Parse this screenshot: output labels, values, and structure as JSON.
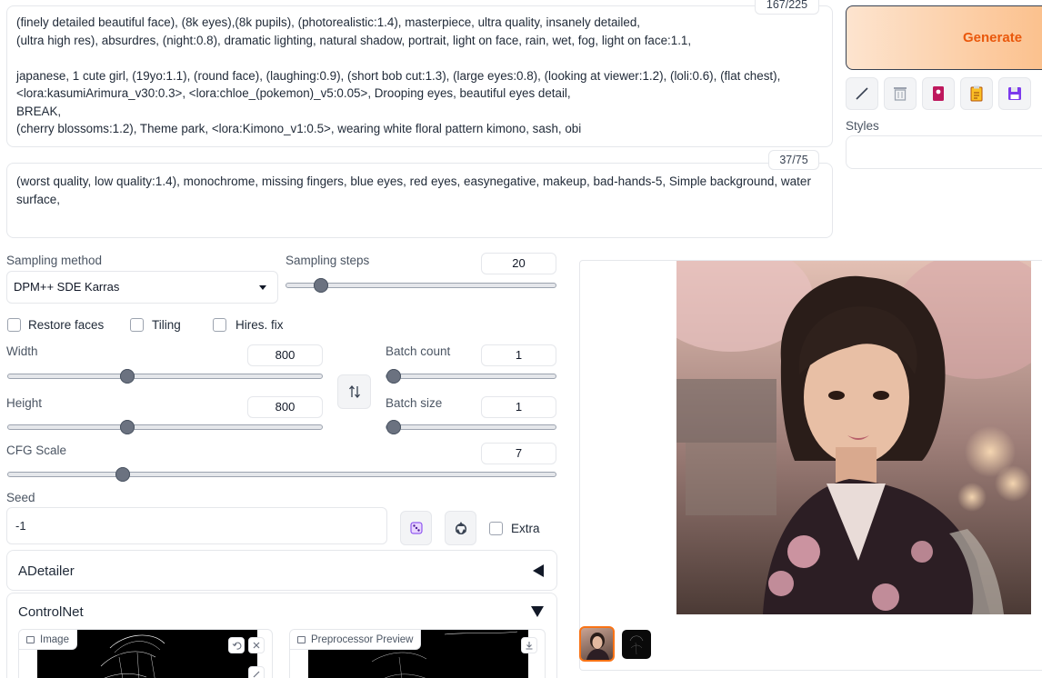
{
  "prompt": {
    "token_counter": "167/225",
    "text": "(finely detailed beautiful face), (8k eyes),(8k pupils), (photorealistic:1.4), masterpiece, ultra quality, insanely detailed,\n(ultra high res), absurdres, (night:0.8), dramatic lighting, natural shadow, portrait, light on face, rain, wet, fog, light on face:1.1,\n\njapanese, 1 cute girl, (19yo:1.1), (round face), (laughing:0.9), (short bob cut:1.3), (large eyes:0.8), (looking at viewer:1.2), (loli:0.6), (flat chest),\n<lora:kasumiArimura_v30:0.3>, <lora:chloe_(pokemon)_v5:0.05>, Drooping eyes, beautiful eyes detail,\nBREAK,\n(cherry blossoms:1.2), Theme park, <lora:Kimono_v1:0.5>, wearing white floral pattern kimono, sash, obi"
  },
  "negative_prompt": {
    "token_counter": "37/75",
    "text": "(worst quality, low quality:1.4), monochrome, missing fingers, blue eyes, red eyes, easynegative, makeup, bad-hands-5, Simple background, water\nsurface,"
  },
  "generate": {
    "label": "Generate"
  },
  "tools": [
    "pencil-icon",
    "trash-icon",
    "bookmark-icon",
    "clipboard-icon",
    "save-icon"
  ],
  "styles": {
    "label": "Styles"
  },
  "sampling": {
    "method_label": "Sampling method",
    "method_value": "DPM++ SDE Karras",
    "steps_label": "Sampling steps",
    "steps_value": "20",
    "steps_fraction": 0.13
  },
  "checkboxes": {
    "restore_faces": "Restore faces",
    "tiling": "Tiling",
    "hires_fix": "Hires. fix"
  },
  "width": {
    "label": "Width",
    "value": "800",
    "fraction": 0.38
  },
  "height": {
    "label": "Height",
    "value": "800",
    "fraction": 0.38
  },
  "batch_count": {
    "label": "Batch count",
    "value": "1",
    "fraction": 0.0
  },
  "batch_size": {
    "label": "Batch size",
    "value": "1",
    "fraction": 0.0
  },
  "cfg": {
    "label": "CFG Scale",
    "value": "7",
    "fraction": 0.21
  },
  "seed": {
    "label": "Seed",
    "value": "-1",
    "extra_label": "Extra"
  },
  "adetailer": {
    "label": "ADetailer"
  },
  "controlnet": {
    "label": "ControlNet",
    "image_label": "Image",
    "preview_label": "Preprocessor Preview"
  },
  "colors": {
    "generate_start": "#fcdcc4",
    "generate_end": "#fbbf8a",
    "generate_text": "#ea580c",
    "thumb_selected_border": "#f97316"
  }
}
